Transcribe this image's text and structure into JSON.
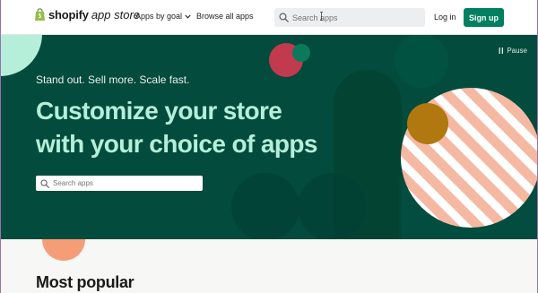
{
  "header": {
    "logo_word": "shopify",
    "logo_sub": "app store",
    "nav_goal": "Apps by goal",
    "nav_browse": "Browse all apps",
    "search_placeholder": "Search apps",
    "login": "Log in",
    "signup": "Sign up"
  },
  "hero": {
    "pause_label": "Pause",
    "tagline": "Stand out. Sell more. Scale fast.",
    "title": "Customize your store with your choice of apps",
    "search_placeholder": "Search apps"
  },
  "section": {
    "title": "Most popular"
  },
  "colors": {
    "brand_green": "#008060",
    "hero_bg": "#024b3d",
    "hero_title": "#b5efd9",
    "stripe_salmon": "#f5b9a3"
  },
  "icons": [
    "shopify-bag-icon",
    "chevron-down-icon",
    "search-icon",
    "text-cursor-icon",
    "pause-icon"
  ]
}
